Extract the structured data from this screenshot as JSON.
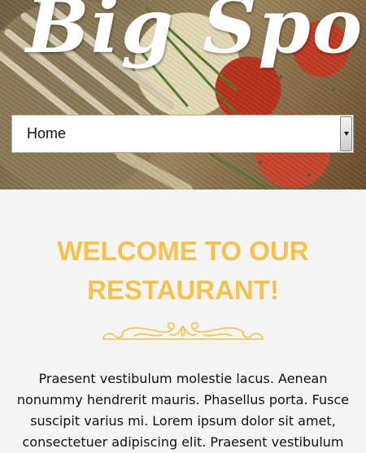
{
  "site": {
    "brand": "Big Spoon"
  },
  "nav": {
    "selected": "Home",
    "arrow_icon": "chevron-down-icon"
  },
  "welcome": {
    "title": "WELCOME TO OUR RESTAURANT!",
    "ornament_icon": "ornament-divider-icon",
    "text": "Praesent vestibulum molestie lacus. Aenean nonummy hendrerit mauris. Phasellus porta. Fusce suscipit varius mi. Lorem ipsum dolor sit amet, consectetuer adipiscing elit. Praesent vestibulum"
  },
  "colors": {
    "accent": "#f6c24b",
    "page_background": "#f5f5f5",
    "text": "#111111"
  }
}
